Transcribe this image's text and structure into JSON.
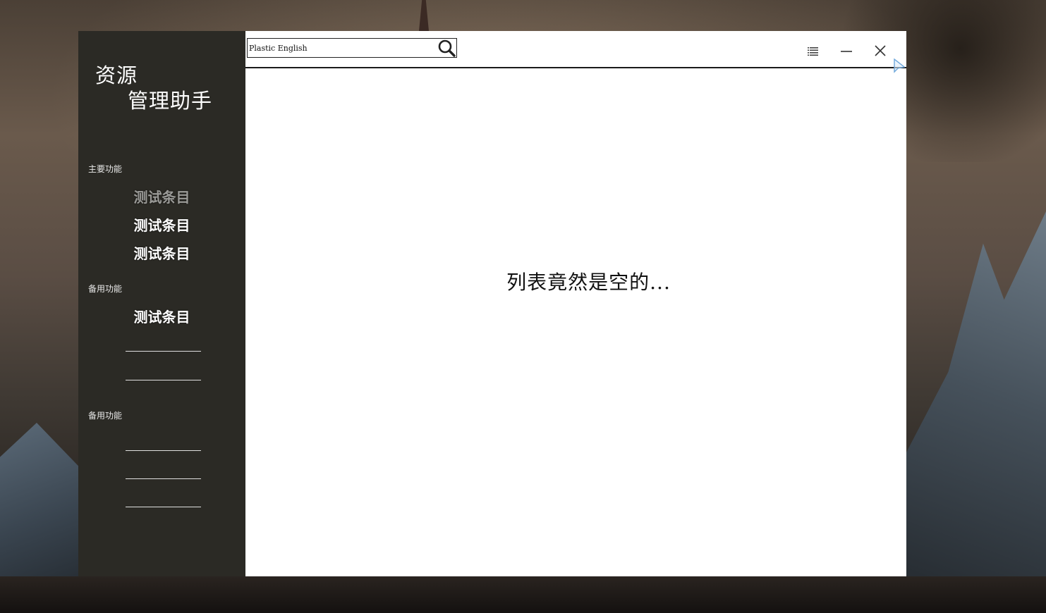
{
  "app": {
    "title_line1": "资源",
    "title_line2": "管理助手"
  },
  "sidebar": {
    "section_main": "主要功能",
    "main_items": [
      {
        "label": "测试条目",
        "state": "dimmed"
      },
      {
        "label": "测试条目",
        "state": "normal"
      },
      {
        "label": "测试条目",
        "state": "normal"
      }
    ],
    "section_backup_1": "备用功能",
    "backup_items_1": [
      {
        "label": "测试条目"
      }
    ],
    "section_backup_2": "备用功能"
  },
  "search": {
    "value": "Plastic English",
    "icon": "search-icon"
  },
  "window_controls": {
    "menu_icon": "list-menu-icon",
    "minimize_icon": "minimize-icon",
    "close_icon": "close-icon"
  },
  "main": {
    "empty_message": "列表竟然是空的..."
  },
  "colors": {
    "sidebar_bg": "#2b2a25",
    "content_bg": "#ffffff",
    "text_light": "#ffffff",
    "text_dim": "#9a9a97"
  }
}
